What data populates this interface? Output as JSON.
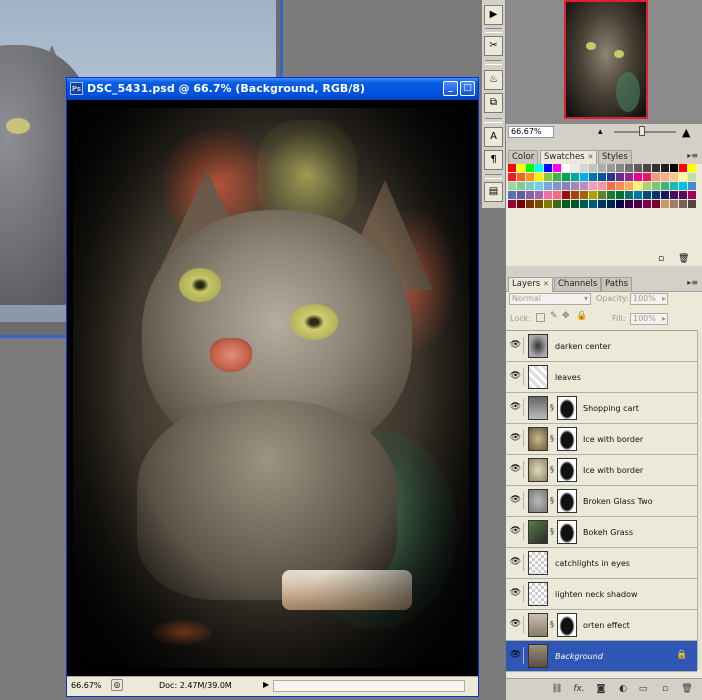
{
  "document": {
    "title": "DSC_5431.psd @ 66.7% (Background, RGB/8)",
    "app_icon": "Ps",
    "zoom": "66.67%",
    "doc_info": "Doc: 2.47M/39.0M"
  },
  "navigator": {
    "zoom": "66.67%"
  },
  "swatches_panel": {
    "tabs": [
      "Color",
      "Swatches",
      "Styles"
    ],
    "active_tab": "Swatches"
  },
  "layers_panel": {
    "tabs": [
      "Layers",
      "Channels",
      "Paths"
    ],
    "active_tab": "Layers",
    "blend_mode": "Normal",
    "opacity_label": "Opacity:",
    "opacity_value": "100%",
    "lock_label": "Lock:",
    "fill_label": "Fill:",
    "fill_value": "100%",
    "layers": [
      {
        "name": "darken center",
        "mask": false
      },
      {
        "name": "leaves",
        "mask": false
      },
      {
        "name": "Shopping cart",
        "mask": true
      },
      {
        "name": "Ice with border",
        "mask": true
      },
      {
        "name": "Ice with border",
        "mask": true
      },
      {
        "name": "Broken Glass Two",
        "mask": true
      },
      {
        "name": "Bokeh Grass",
        "mask": true
      },
      {
        "name": "catchlights in eyes",
        "mask": false
      },
      {
        "name": "lighten neck shadow",
        "mask": false
      },
      {
        "name": "orten effect",
        "mask": true
      },
      {
        "name": "Background",
        "mask": false,
        "selected": true
      }
    ]
  },
  "colors": {
    "title_bar": "#0052e0",
    "selected_layer": "#2e56b4",
    "panel_bg": "#ece9d8"
  }
}
